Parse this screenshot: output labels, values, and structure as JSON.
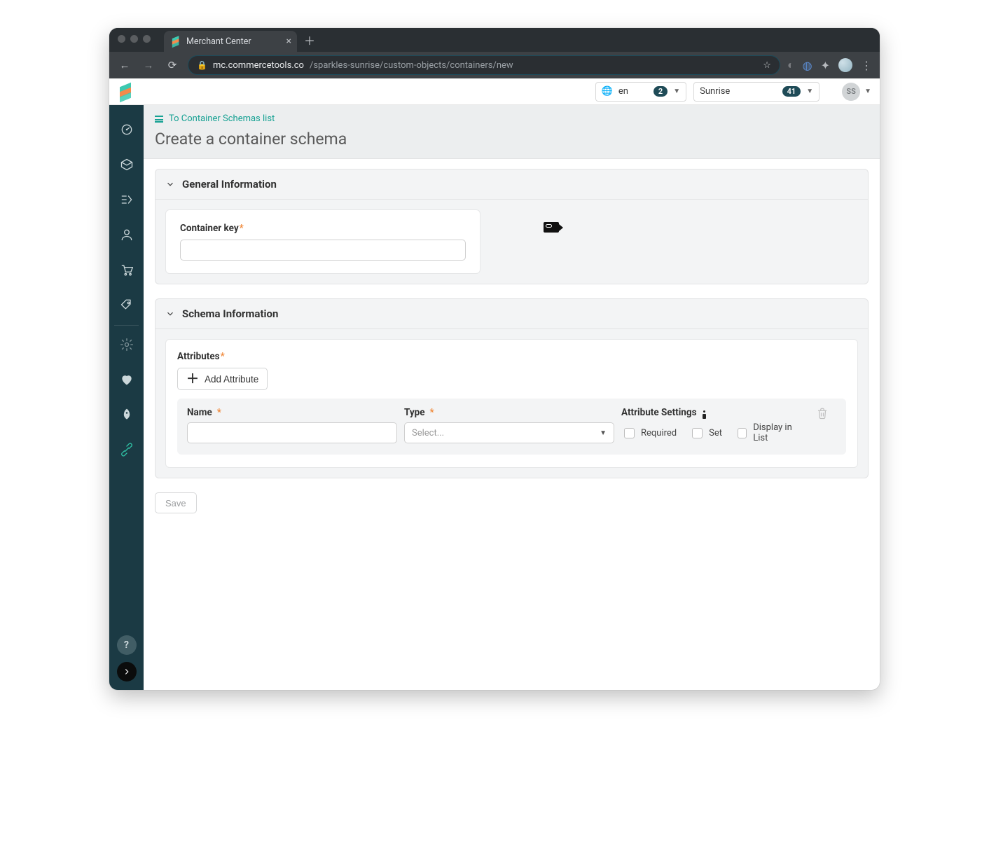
{
  "browser": {
    "tab_title": "Merchant Center",
    "url_host": "mc.commercetools.co",
    "url_path": "/sparkles-sunrise/custom-objects/containers/new"
  },
  "topbar": {
    "locale": "en",
    "locale_badge": "2",
    "project": "Sunrise",
    "project_badge": "41",
    "avatar_initials": "SS"
  },
  "header": {
    "back_link": "To Container Schemas list",
    "title": "Create a container schema"
  },
  "sections": {
    "general": {
      "title": "General Information",
      "container_key_label": "Container key",
      "container_key_value": ""
    },
    "schema": {
      "title": "Schema Information",
      "attributes_label": "Attributes",
      "add_attribute_label": "Add Attribute",
      "cols": {
        "name": "Name",
        "type": "Type",
        "settings": "Attribute Settings"
      },
      "type_placeholder": "Select...",
      "checks": {
        "required": "Required",
        "set": "Set",
        "display": "Display in List"
      },
      "row": {
        "name_value": ""
      }
    }
  },
  "actions": {
    "save": "Save"
  }
}
